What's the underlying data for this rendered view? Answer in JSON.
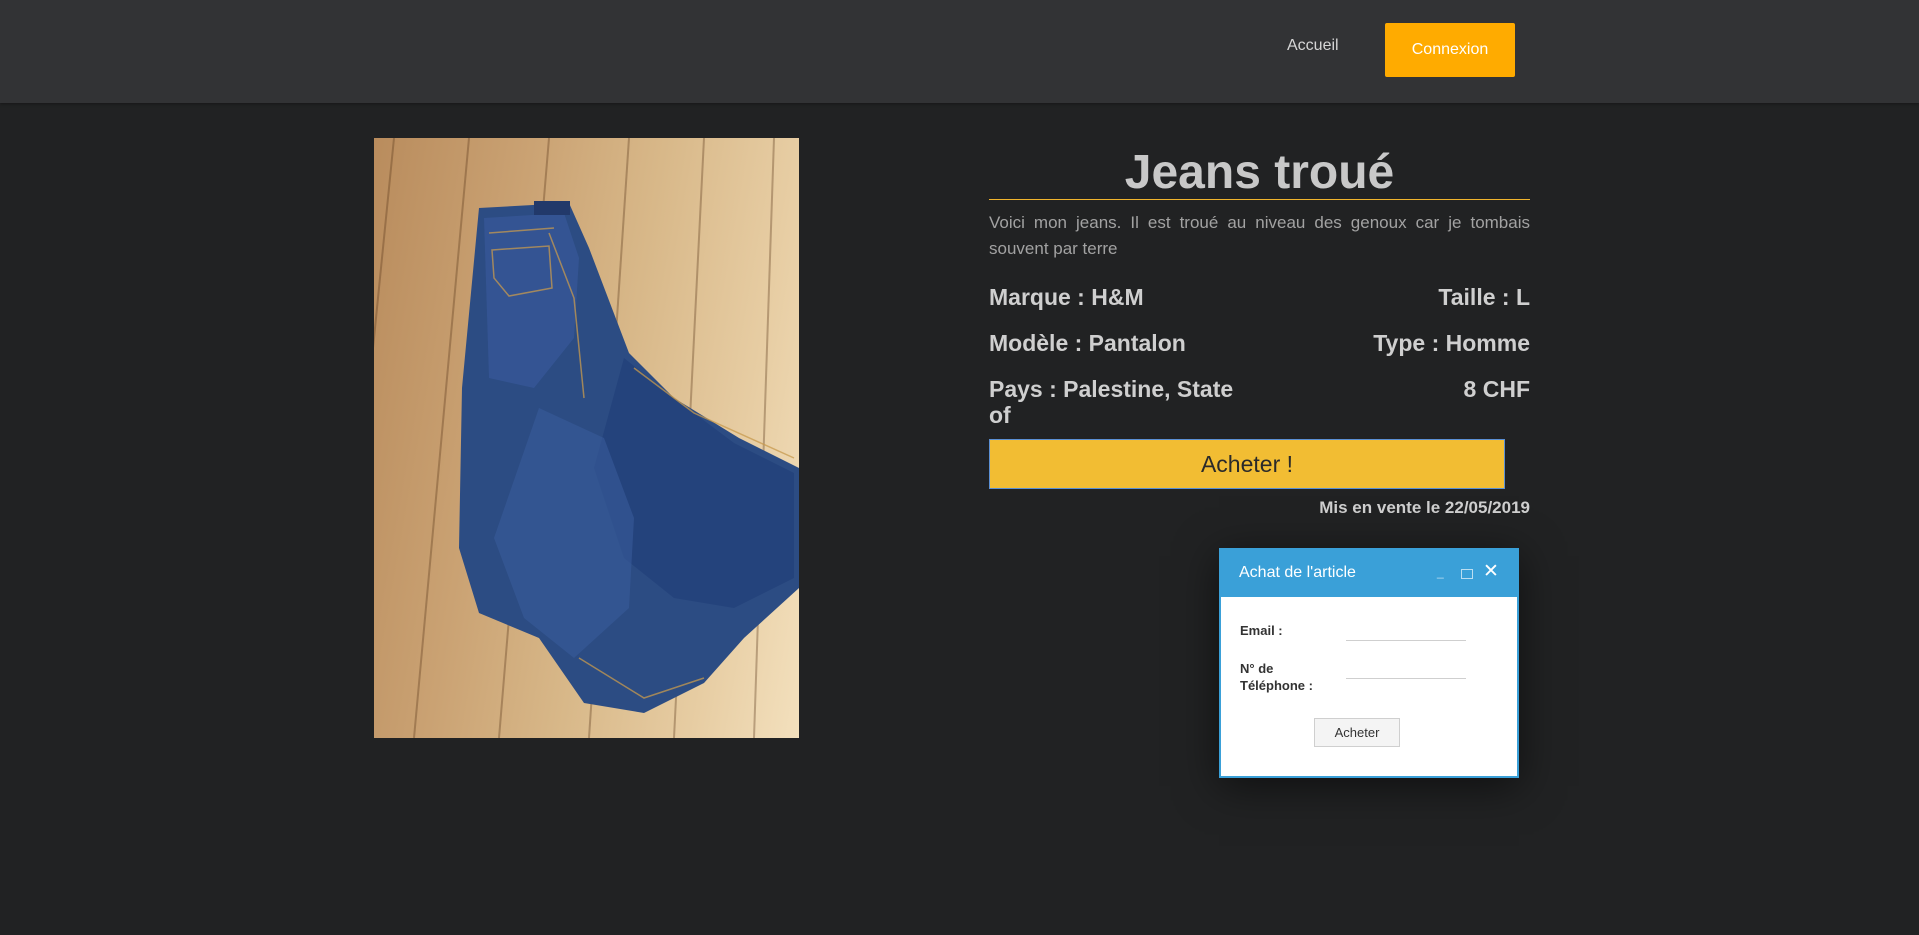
{
  "nav": {
    "home_label": "Accueil",
    "login_label": "Connexion"
  },
  "product": {
    "title": "Jeans troué",
    "description": "Voici mon jeans. Il est troué au niveau des genoux car je tombais souvent par terre",
    "brand": "Marque : H&M",
    "size": "Taille : L",
    "model": "Modèle : Pantalon",
    "type": "Type : Homme",
    "country": "Pays : Palestine, State of",
    "price": "8 CHF",
    "buy_label": "Acheter !",
    "listed_date": "Mis en vente le 22/05/2019"
  },
  "dialog": {
    "title": "Achat de l'article",
    "email_label": "Email :",
    "phone_label": "N° de Téléphone :",
    "email_value": "",
    "phone_value": "",
    "submit_label": "Acheter"
  },
  "colors": {
    "accent": "#ffab00",
    "buy_button": "#f2bd33",
    "dialog_header": "#3aa0d8",
    "background": "#212223",
    "navbar": "#323335"
  },
  "icons": [
    "minimize-icon",
    "maximize-icon",
    "close-icon"
  ]
}
